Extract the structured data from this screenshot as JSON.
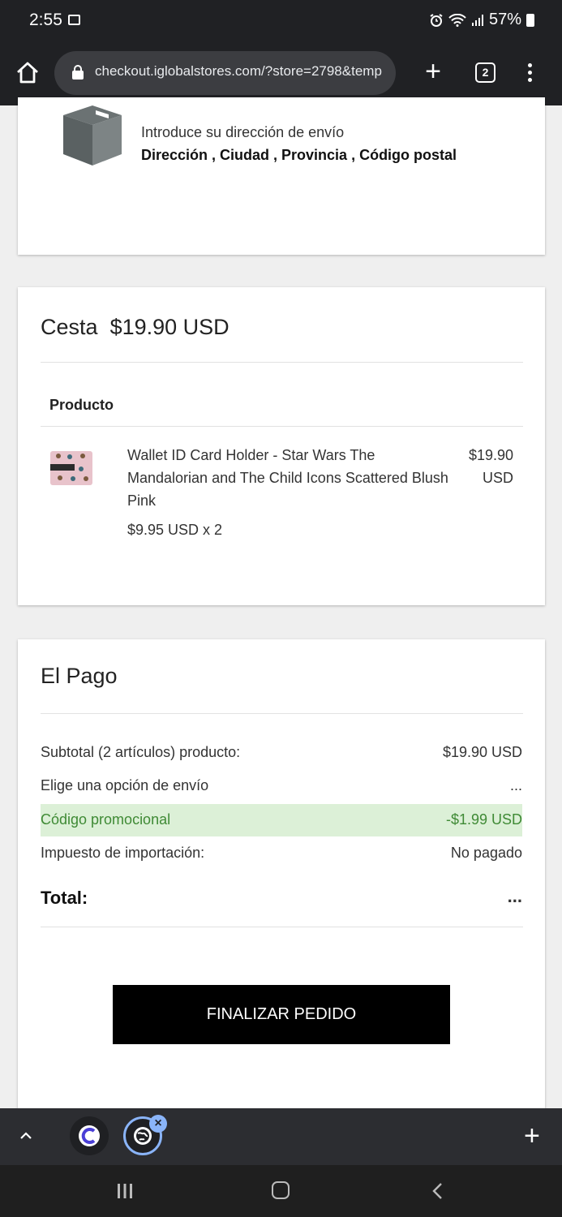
{
  "status_bar": {
    "time": "2:55",
    "battery": "57%"
  },
  "browser": {
    "url": "checkout.iglobalstores.com/?store=2798&temp",
    "tab_count": "2"
  },
  "address": {
    "intro": "Introduce su dirección de envío",
    "fields": "Dirección , Ciudad , Provincia , Código postal"
  },
  "basket": {
    "title": "Cesta",
    "total": "$19.90 USD",
    "column_header": "Producto",
    "items": [
      {
        "name": "Wallet ID Card Holder - Star Wars The Mandalorian and The Child Icons Scattered Blush Pink",
        "price_amount": "$19.90",
        "price_currency": "USD",
        "unit_price": "$9.95 USD x 2"
      }
    ]
  },
  "payment": {
    "title": "El Pago",
    "rows": [
      {
        "label": "Subtotal (2 artículos) producto:",
        "value": "$19.90 USD"
      },
      {
        "label": "Elige una opción de envío",
        "value": "..."
      },
      {
        "label": "Código promocional",
        "value": "-$1.99 USD"
      },
      {
        "label": "Impuesto de importación:",
        "value": "No pagado"
      }
    ],
    "total_label": "Total:",
    "total_value": "...",
    "submit_label": "FINALIZAR PEDIDO"
  },
  "colors": {
    "promo_bg": "#dcf0d7",
    "promo_text": "#3f8a35",
    "button_bg": "#000000",
    "chrome_dark": "#202124"
  },
  "icons": [
    "image-icon",
    "alarm-icon",
    "wifi-icon",
    "signal-icon",
    "battery-icon",
    "home-icon",
    "lock-icon",
    "new-tab-icon",
    "tab-switcher-icon",
    "overflow-menu-icon",
    "shipping-box-icon",
    "chevron-up-icon",
    "close-icon",
    "recent-apps-icon",
    "back-icon"
  ]
}
